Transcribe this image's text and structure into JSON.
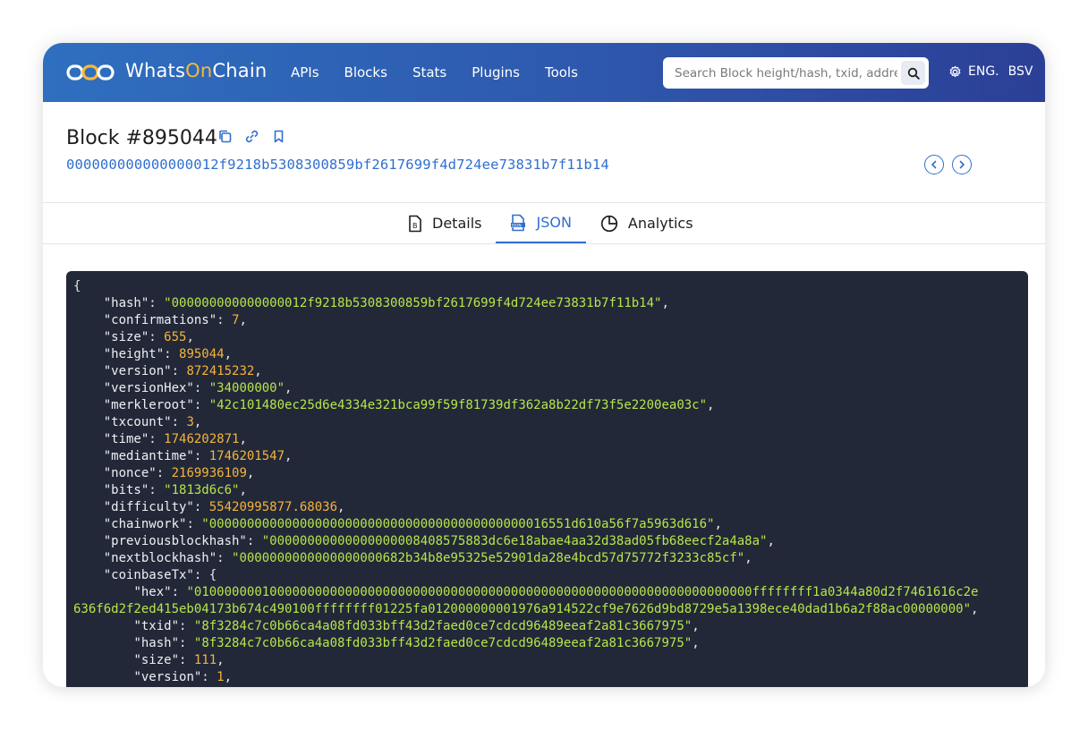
{
  "header": {
    "brand_prefix": "Whats",
    "brand_highlight": "On",
    "brand_suffix": "Chain",
    "nav": [
      "APIs",
      "Blocks",
      "Stats",
      "Plugins",
      "Tools"
    ],
    "search_placeholder": "Search Block height/hash, txid, address",
    "language": "ENG.",
    "network": "BSV"
  },
  "block": {
    "title": "Block #895044",
    "hash": "000000000000000012f9218b5308300859bf2617699f4d724ee73831b7f11b14"
  },
  "tabs": [
    {
      "label": "Details",
      "icon": "document-icon"
    },
    {
      "label": "JSON",
      "icon": "json-file-icon",
      "active": true
    },
    {
      "label": "Analytics",
      "icon": "pie-chart-icon"
    }
  ],
  "json": {
    "hash": "000000000000000012f9218b5308300859bf2617699f4d724ee73831b7f11b14",
    "confirmations": "7",
    "size": "655",
    "height": "895044",
    "version": "872415232",
    "versionHex": "34000000",
    "merkleroot": "42c101480ec25d6e4334e321bca99f59f81739df362a8b22df73f5e2200ea03c",
    "txcount": "3",
    "time": "1746202871",
    "mediantime": "1746201547",
    "nonce": "2169936109",
    "bits": "1813d6c6",
    "difficulty": "55420995877.68036",
    "chainwork": "000000000000000000000000000000000000000000016551d610a56f7a5963d616",
    "previousblockhash": "00000000000000000008408575883dc6e18abae4aa32d38ad05fb68eecf2a4a8a",
    "nextblockhash": "0000000000000000000682b34b8e95325e52901da28e4bcd57d75772f3233c85cf",
    "coinbaseTx": {
      "hex_line1": "01000000010000000000000000000000000000000000000000000000000000000000000000ffffffff1a0344a80d2f7461616c2e",
      "hex_line2": "636f6d2f2ed415eb04173b674c490100ffffffff01225fa012000000001976a914522cf9e7626d9bd8729e5a1398ece40dad1b6a2f88ac00000000",
      "txid": "8f3284c7c0b66ca4a08fd033bff43d2faed0ce7cdcd96489eeaf2a81c3667975",
      "hash": "8f3284c7c0b66ca4a08fd033bff43d2faed0ce7cdcd96489eeaf2a81c3667975",
      "size": "111",
      "version": "1"
    }
  },
  "colors": {
    "header_start": "#2f6fbf",
    "header_end": "#2c3f96",
    "accent": "#2f6fd0",
    "brand_highlight": "#f6b93b",
    "json_bg": "#222838",
    "json_string": "#b7e54a",
    "json_number": "#f4b43a"
  }
}
